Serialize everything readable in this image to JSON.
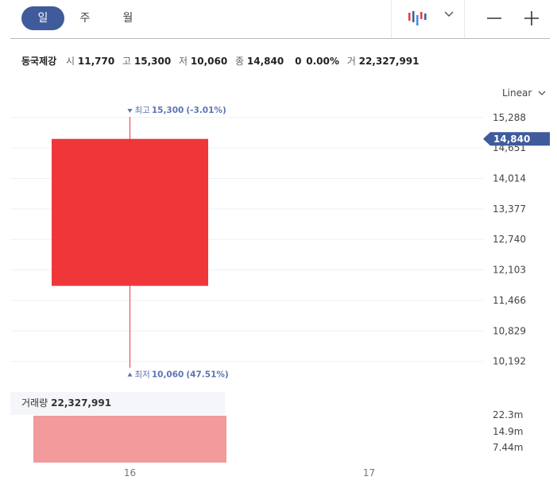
{
  "toolbar": {
    "period_tabs": [
      {
        "label": "일",
        "active": true
      },
      {
        "label": "주",
        "active": false
      },
      {
        "label": "월",
        "active": false
      }
    ],
    "chart_type_icon": "candlestick-icon",
    "zoom_out_icon": "minus-icon",
    "zoom_in_icon": "plus-icon"
  },
  "info": {
    "name": "동국제강",
    "open_label": "시",
    "open": "11,770",
    "high_label": "고",
    "high": "15,300",
    "low_label": "저",
    "low": "10,060",
    "close_label": "종",
    "close": "14,840",
    "change": "0",
    "change_pct": "0.00%",
    "volume_label": "거",
    "volume": "22,327,991"
  },
  "scale_label": "Linear",
  "colors": {
    "up": "#ef3639",
    "volume_bar": "#f29a9c",
    "accent": "#3f5b9b",
    "marker_text": "#5b74b4"
  },
  "chart_data": {
    "type": "candlestick",
    "x": [
      "16",
      "17"
    ],
    "candles": [
      {
        "x": "16",
        "open": 11770,
        "high": 15300,
        "low": 10060,
        "close": 14840
      }
    ],
    "y_ticks": [
      "15,288",
      "14,651",
      "14,014",
      "13,377",
      "12,740",
      "12,103",
      "11,466",
      "10,829",
      "10,192"
    ],
    "ylim": [
      9855,
      15500
    ],
    "current_price_label": "14,840",
    "current_price": 14840,
    "high_marker": {
      "label": "최고",
      "value": "15,300",
      "pct": "(-3.01%)"
    },
    "low_marker": {
      "label": "최저",
      "value": "10,060",
      "pct": "(47.51%)"
    },
    "volume": {
      "label": "거래량",
      "value_text": "22,327,991",
      "values": [
        22327991
      ],
      "y_ticks": [
        "22.3m",
        "14.9m",
        "7.44m"
      ],
      "ylim": [
        0,
        22327991
      ]
    }
  }
}
